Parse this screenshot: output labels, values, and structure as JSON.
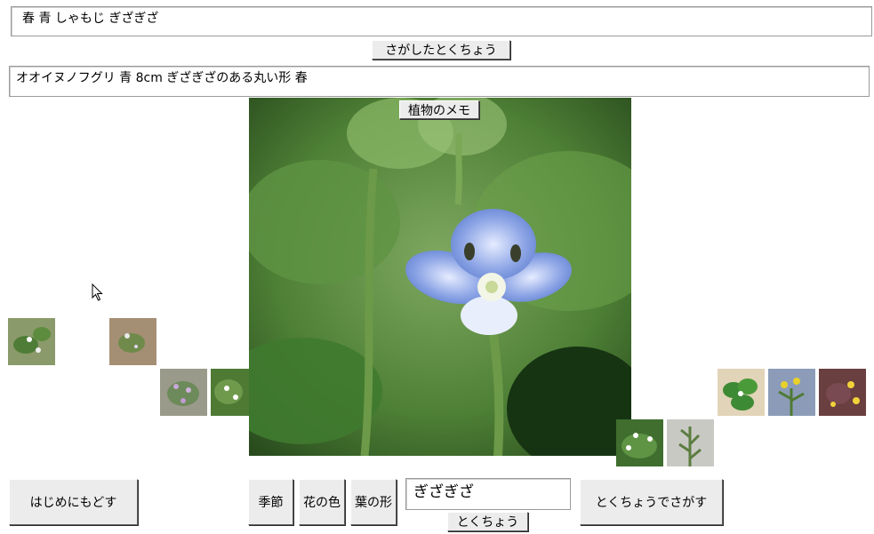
{
  "top_field": {
    "value": "春 青 しゃもじ ぎざぎざ"
  },
  "search_result_button": {
    "label": "さがしたとくちょう"
  },
  "memo_field": {
    "value": "オオイヌノフグリ 青 8cm ぎざぎざのある丸い形 春"
  },
  "memo_button": {
    "label": "植物のメモ"
  },
  "bottom": {
    "restart_label": "はじめにもどす",
    "season_label": "季節",
    "flower_color_label": "花の色",
    "leaf_shape_label": "葉の形",
    "feature_input_value": "ぎざぎざ",
    "feature_button_label": "とくちょう",
    "search_by_feature_label": "とくちょうでさがす"
  },
  "colors": {
    "petal_blue": "#6f8fd8",
    "leaf_green": "#4f8a3a",
    "button_face": "#ececec"
  },
  "icons": [
    "mouse-cursor-icon"
  ]
}
